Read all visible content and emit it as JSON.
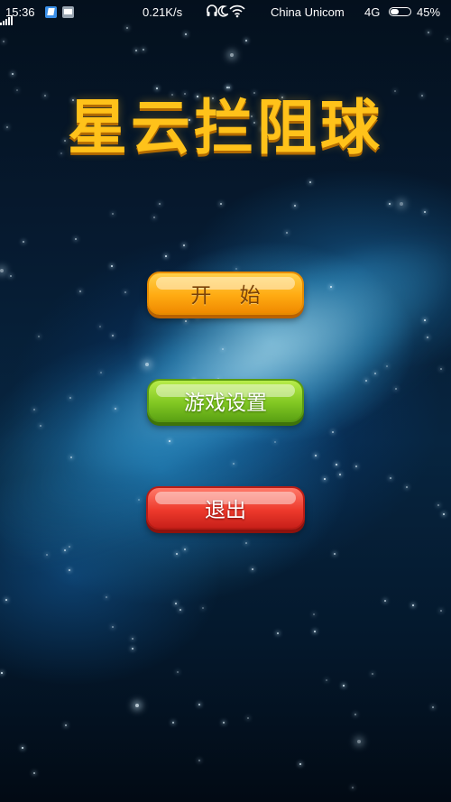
{
  "status_bar": {
    "time": "15:36",
    "speed": "0.21K/s",
    "carrier": "China  Unicom",
    "network": "4G",
    "battery": "45%",
    "battery_level": 0.45,
    "icons": [
      "app-notification-icon",
      "gallery-notification-icon",
      "headset-icon",
      "moon-icon",
      "wifi-icon",
      "signal-icon",
      "battery-icon"
    ]
  },
  "game": {
    "title": "星云拦阻球",
    "title_color": "#ffc21a"
  },
  "menu": {
    "start_label": "开 始",
    "settings_label": "游戏设置",
    "exit_label": "退出",
    "colors": {
      "start": "#ffab12",
      "settings": "#82c823",
      "exit": "#ee3a2c"
    }
  }
}
